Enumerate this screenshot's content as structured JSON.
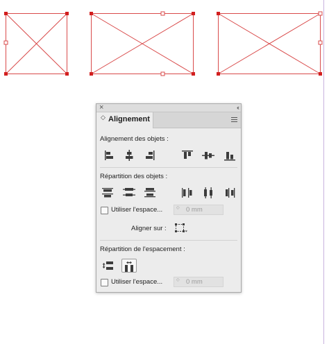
{
  "colors": {
    "frame_stroke": "#d94a4a",
    "handle_selected": "#d21f1f",
    "guide": "#c9b3de",
    "panel_bg": "#ececec",
    "icon_dark": "#3c3c3c"
  },
  "panel": {
    "close_symbol": "×",
    "collapse_symbol": "‹‹",
    "tab_chevron": "◇",
    "tab_label": "Alignement",
    "section_align_objects": "Alignement des objets :",
    "section_distribute_objects": "Répartition des objets :",
    "section_distribute_spacing": "Répartition de l'espacement :",
    "use_spacing_label": "Utiliser l'espace...",
    "spacing_value": "0 mm",
    "spacing_value_2": "0 mm",
    "spin_symbol": "◇",
    "align_on_label": "Aligner sur :"
  },
  "icons": {
    "align_objects": [
      "align-left-edges-icon",
      "align-horizontal-centers-icon",
      "align-right-edges-icon",
      "align-top-edges-icon",
      "align-vertical-centers-icon",
      "align-bottom-edges-icon"
    ],
    "distribute_objects": [
      "distribute-top-edges-icon",
      "distribute-vertical-centers-icon",
      "distribute-bottom-edges-icon",
      "distribute-left-edges-icon",
      "distribute-horizontal-centers-icon",
      "distribute-right-edges-icon"
    ],
    "distribute_spacing": [
      "distribute-vertical-space-icon",
      "distribute-horizontal-space-icon"
    ],
    "align_target": "align-to-selection-icon"
  }
}
